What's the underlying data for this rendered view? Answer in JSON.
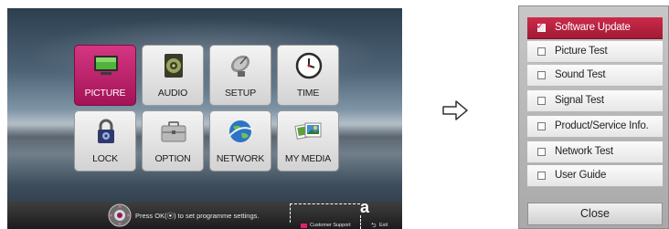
{
  "home_menu": {
    "tiles": [
      {
        "label": "PICTURE",
        "icon": "monitor-icon",
        "selected": true
      },
      {
        "label": "AUDIO",
        "icon": "speaker-icon",
        "selected": false
      },
      {
        "label": "SETUP",
        "icon": "satellite-dish-icon",
        "selected": false
      },
      {
        "label": "TIME",
        "icon": "clock-icon",
        "selected": false
      },
      {
        "label": "LOCK",
        "icon": "padlock-icon",
        "selected": false
      },
      {
        "label": "OPTION",
        "icon": "toolbox-icon",
        "selected": false
      },
      {
        "label": "NETWORK",
        "icon": "globe-icon",
        "selected": false
      },
      {
        "label": "MY MEDIA",
        "icon": "photos-icon",
        "selected": false
      }
    ],
    "hint": "Press OK(⦿) to set programme settings.",
    "callout": "a",
    "customer_support": "Customer Support",
    "exit": "Exit"
  },
  "service_menu": {
    "items": [
      {
        "label": "Software Update",
        "selected": true
      },
      {
        "label": "Picture Test",
        "selected": false
      },
      {
        "label": "Sound Test",
        "selected": false
      },
      {
        "label": "Signal Test",
        "selected": false
      },
      {
        "label": "Product/Service Info.",
        "selected": false
      },
      {
        "label": "Network Test",
        "selected": false
      },
      {
        "label": "User Guide",
        "selected": false
      }
    ],
    "close_label": "Close"
  },
  "colors": {
    "selected_tile": "#c12a70",
    "selected_item": "#b8233f",
    "accent_badge": "#e0206f"
  }
}
